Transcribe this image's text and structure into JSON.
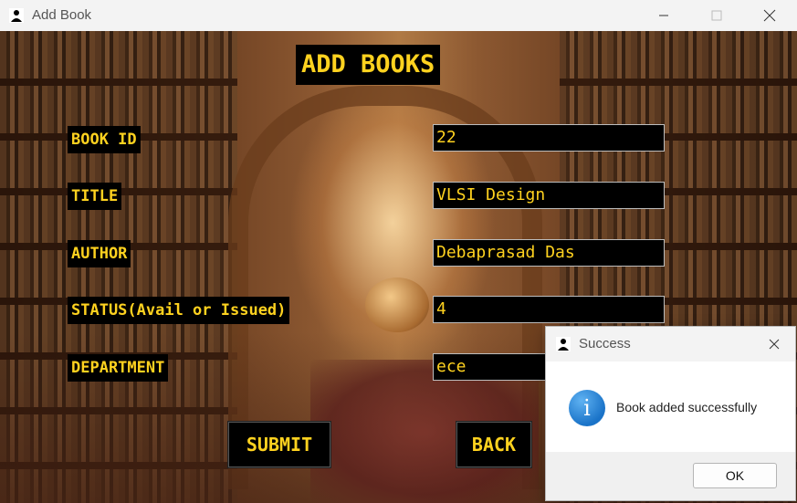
{
  "window": {
    "title": "Add Book"
  },
  "form": {
    "heading": "ADD BOOKS",
    "labels": {
      "book_id": "BOOK ID",
      "title": "TITLE",
      "author": "AUTHOR",
      "status": "STATUS(Avail or Issued)",
      "department": "DEPARTMENT"
    },
    "values": {
      "book_id": "22",
      "title": "VLSI Design",
      "author": "Debaprasad Das",
      "status": "4",
      "department": "ece"
    },
    "buttons": {
      "submit": "SUBMIT",
      "back": "BACK"
    }
  },
  "dialog": {
    "title": "Success",
    "message": "Book added successfully",
    "ok": "OK",
    "icon": "info-icon"
  },
  "colors": {
    "accent": "#ffd21f",
    "label_bg": "#000000"
  }
}
